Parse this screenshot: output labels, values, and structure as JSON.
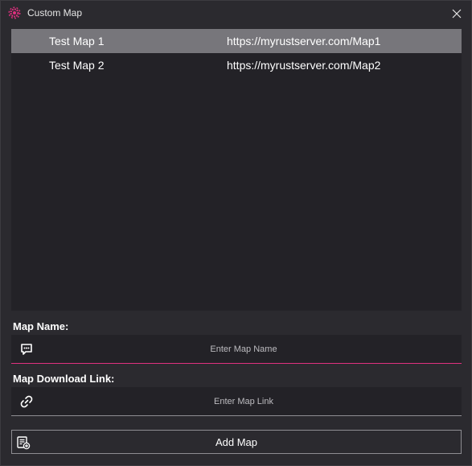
{
  "window": {
    "title": "Custom Map",
    "accent_color": "#e0307f",
    "close_icon": "close-icon",
    "app_icon": "gear-badge-icon"
  },
  "maps": [
    {
      "name": "Test Map 1",
      "url": "https://myrustserver.com/Map1",
      "selected": true
    },
    {
      "name": "Test Map 2",
      "url": "https://myrustserver.com/Map2",
      "selected": false
    }
  ],
  "form": {
    "map_name_label": "Map Name:",
    "map_name_placeholder": "Enter Map Name",
    "map_name_icon": "chat-icon",
    "map_link_label": "Map Download Link:",
    "map_link_placeholder": "Enter Map Link",
    "map_link_icon": "link-icon"
  },
  "actions": {
    "add_map_label": "Add Map",
    "add_map_icon": "add-list-icon"
  }
}
